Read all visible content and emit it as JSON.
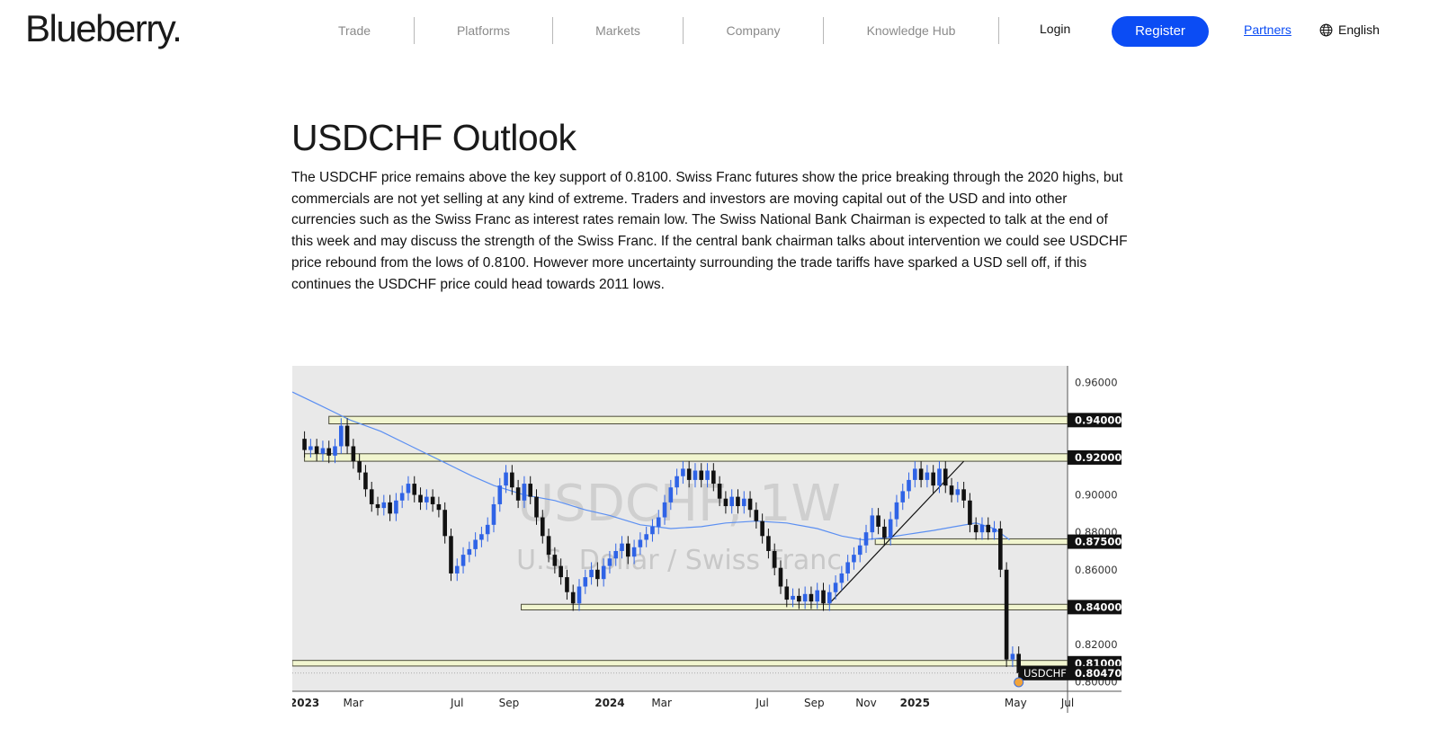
{
  "brand": {
    "logo_text": "Blueberry."
  },
  "nav": {
    "items": [
      "Trade",
      "Platforms",
      "Markets",
      "Company",
      "Knowledge Hub"
    ],
    "login": "Login",
    "register": "Register",
    "partners": "Partners",
    "language": "English"
  },
  "article": {
    "title": "USDCHF Outlook",
    "body": "The USDCHF price remains above the key support of 0.8100. Swiss Franc futures show the price breaking through the 2020 highs, but commercials are not yet selling at any kind of extreme. Traders and investors are moving capital out of the USD and into other currencies such as the Swiss Franc as interest rates remain low. The Swiss National Bank Chairman is expected to talk at the end of this week and may discuss the strength of the Swiss Franc. If the central bank chairman talks about intervention we could see USDCHF price rebound from the lows of 0.8100. However more uncertainty surrounding the trade tariffs have sparked a USD sell off, if this continues the USDCHF price could head towards 2011 lows."
  },
  "chart_data": {
    "type": "candlestick",
    "watermark": {
      "symbol": "USDCHF, 1W",
      "description": "U.S. Dollar / Swiss Franc"
    },
    "ylim": [
      0.795,
      0.969
    ],
    "y_ticks": [
      0.96,
      0.94,
      0.92,
      0.9,
      0.88,
      0.86,
      0.84,
      0.82,
      0.81,
      0.8
    ],
    "y_tick_labels": [
      "0.96000",
      "0.94000",
      "0.92000",
      "0.90000",
      "0.88000",
      "0.86000",
      "0.84000",
      "0.82000",
      "0.81000",
      "0.80000"
    ],
    "x_labels": [
      {
        "t": 2023.0,
        "label": "2023",
        "bold": true
      },
      {
        "t": 2023.16,
        "label": "Mar",
        "bold": false
      },
      {
        "t": 2023.5,
        "label": "Jul",
        "bold": false
      },
      {
        "t": 2023.67,
        "label": "Sep",
        "bold": false
      },
      {
        "t": 2024.0,
        "label": "2024",
        "bold": true
      },
      {
        "t": 2024.17,
        "label": "Mar",
        "bold": false
      },
      {
        "t": 2024.5,
        "label": "Jul",
        "bold": false
      },
      {
        "t": 2024.67,
        "label": "Sep",
        "bold": false
      },
      {
        "t": 2024.84,
        "label": "Nov",
        "bold": false
      },
      {
        "t": 2025.0,
        "label": "2025",
        "bold": true
      },
      {
        "t": 2025.33,
        "label": "May",
        "bold": false
      },
      {
        "t": 2025.5,
        "label": "Jul",
        "bold": false
      }
    ],
    "x_range": [
      2022.96,
      2025.5
    ],
    "support_zones": [
      {
        "price": 0.94,
        "label": "0.94000",
        "from": 2023.08,
        "width": 0.004
      },
      {
        "price": 0.92,
        "label": "0.92000",
        "from": 2023.0,
        "width": 0.004
      },
      {
        "price": 0.875,
        "label": "0.87500",
        "from": 2024.87,
        "width": 0.003
      },
      {
        "price": 0.84,
        "label": "0.84000",
        "from": 2023.71,
        "width": 0.003
      },
      {
        "price": 0.81,
        "label": "0.81000",
        "from": 2022.96,
        "width": 0.003
      }
    ],
    "current_price": {
      "symbol": "USDCHF",
      "value": "0.80470",
      "price": 0.8047
    },
    "trendline": {
      "from": [
        2024.72,
        0.842
      ],
      "to": [
        2025.16,
        0.918
      ]
    },
    "moving_average": [
      [
        2022.96,
        0.955
      ],
      [
        2023.05,
        0.948
      ],
      [
        2023.15,
        0.94
      ],
      [
        2023.25,
        0.934
      ],
      [
        2023.35,
        0.926
      ],
      [
        2023.45,
        0.918
      ],
      [
        2023.55,
        0.91
      ],
      [
        2023.62,
        0.905
      ],
      [
        2023.72,
        0.9
      ],
      [
        2023.82,
        0.897
      ],
      [
        2023.92,
        0.892
      ],
      [
        2024.0,
        0.889
      ],
      [
        2024.1,
        0.884
      ],
      [
        2024.2,
        0.882
      ],
      [
        2024.3,
        0.883
      ],
      [
        2024.38,
        0.885
      ],
      [
        2024.48,
        0.886
      ],
      [
        2024.58,
        0.885
      ],
      [
        2024.68,
        0.882
      ],
      [
        2024.76,
        0.878
      ],
      [
        2024.83,
        0.876
      ],
      [
        2024.9,
        0.877
      ],
      [
        2024.98,
        0.879
      ],
      [
        2025.06,
        0.881
      ],
      [
        2025.13,
        0.883
      ],
      [
        2025.2,
        0.885
      ],
      [
        2025.26,
        0.882
      ],
      [
        2025.31,
        0.876
      ]
    ],
    "candles": [
      [
        2023.0,
        0.93,
        0.924
      ],
      [
        2023.02,
        0.924,
        0.926
      ],
      [
        2023.04,
        0.926,
        0.922
      ],
      [
        2023.06,
        0.922,
        0.925
      ],
      [
        2023.08,
        0.925,
        0.921
      ],
      [
        2023.1,
        0.921,
        0.926
      ],
      [
        2023.12,
        0.926,
        0.937
      ],
      [
        2023.14,
        0.937,
        0.926
      ],
      [
        2023.16,
        0.926,
        0.918
      ],
      [
        2023.18,
        0.918,
        0.912
      ],
      [
        2023.2,
        0.912,
        0.903
      ],
      [
        2023.22,
        0.903,
        0.895
      ],
      [
        2023.24,
        0.895,
        0.893
      ],
      [
        2023.26,
        0.893,
        0.896
      ],
      [
        2023.28,
        0.896,
        0.89
      ],
      [
        2023.3,
        0.89,
        0.897
      ],
      [
        2023.32,
        0.897,
        0.901
      ],
      [
        2023.34,
        0.901,
        0.906
      ],
      [
        2023.36,
        0.906,
        0.9
      ],
      [
        2023.38,
        0.9,
        0.896
      ],
      [
        2023.4,
        0.896,
        0.899
      ],
      [
        2023.42,
        0.899,
        0.895
      ],
      [
        2023.44,
        0.895,
        0.892
      ],
      [
        2023.46,
        0.892,
        0.878
      ],
      [
        2023.48,
        0.878,
        0.858
      ],
      [
        2023.5,
        0.858,
        0.862
      ],
      [
        2023.52,
        0.862,
        0.868
      ],
      [
        2023.54,
        0.868,
        0.871
      ],
      [
        2023.56,
        0.871,
        0.876
      ],
      [
        2023.58,
        0.876,
        0.879
      ],
      [
        2023.6,
        0.879,
        0.884
      ],
      [
        2023.62,
        0.884,
        0.895
      ],
      [
        2023.64,
        0.895,
        0.905
      ],
      [
        2023.66,
        0.905,
        0.912
      ],
      [
        2023.68,
        0.912,
        0.904
      ],
      [
        2023.7,
        0.904,
        0.897
      ],
      [
        2023.72,
        0.897,
        0.906
      ],
      [
        2023.74,
        0.906,
        0.899
      ],
      [
        2023.76,
        0.899,
        0.888
      ],
      [
        2023.78,
        0.888,
        0.878
      ],
      [
        2023.8,
        0.878,
        0.868
      ],
      [
        2023.82,
        0.868,
        0.862
      ],
      [
        2023.84,
        0.862,
        0.856
      ],
      [
        2023.86,
        0.856,
        0.848
      ],
      [
        2023.88,
        0.848,
        0.842
      ],
      [
        2023.9,
        0.842,
        0.851
      ],
      [
        2023.92,
        0.851,
        0.856
      ],
      [
        2023.94,
        0.856,
        0.86
      ],
      [
        2023.96,
        0.86,
        0.855
      ],
      [
        2023.98,
        0.855,
        0.862
      ],
      [
        2024.0,
        0.862,
        0.866
      ],
      [
        2024.02,
        0.866,
        0.87
      ],
      [
        2024.04,
        0.87,
        0.874
      ],
      [
        2024.06,
        0.874,
        0.867
      ],
      [
        2024.08,
        0.867,
        0.872
      ],
      [
        2024.1,
        0.872,
        0.876
      ],
      [
        2024.12,
        0.876,
        0.879
      ],
      [
        2024.14,
        0.879,
        0.883
      ],
      [
        2024.16,
        0.883,
        0.888
      ],
      [
        2024.18,
        0.888,
        0.896
      ],
      [
        2024.2,
        0.896,
        0.904
      ],
      [
        2024.22,
        0.904,
        0.91
      ],
      [
        2024.24,
        0.91,
        0.914
      ],
      [
        2024.26,
        0.914,
        0.908
      ],
      [
        2024.28,
        0.908,
        0.913
      ],
      [
        2024.3,
        0.913,
        0.908
      ],
      [
        2024.32,
        0.908,
        0.913
      ],
      [
        2024.34,
        0.913,
        0.906
      ],
      [
        2024.36,
        0.906,
        0.898
      ],
      [
        2024.38,
        0.898,
        0.894
      ],
      [
        2024.4,
        0.894,
        0.899
      ],
      [
        2024.42,
        0.899,
        0.894
      ],
      [
        2024.44,
        0.894,
        0.898
      ],
      [
        2024.46,
        0.898,
        0.892
      ],
      [
        2024.48,
        0.892,
        0.886
      ],
      [
        2024.5,
        0.886,
        0.878
      ],
      [
        2024.52,
        0.878,
        0.87
      ],
      [
        2024.54,
        0.87,
        0.861
      ],
      [
        2024.56,
        0.861,
        0.851
      ],
      [
        2024.58,
        0.851,
        0.844
      ],
      [
        2024.6,
        0.844,
        0.846
      ],
      [
        2024.62,
        0.846,
        0.843
      ],
      [
        2024.64,
        0.843,
        0.847
      ],
      [
        2024.66,
        0.847,
        0.843
      ],
      [
        2024.68,
        0.843,
        0.849
      ],
      [
        2024.7,
        0.849,
        0.842
      ],
      [
        2024.72,
        0.842,
        0.848
      ],
      [
        2024.74,
        0.848,
        0.853
      ],
      [
        2024.76,
        0.853,
        0.858
      ],
      [
        2024.78,
        0.858,
        0.864
      ],
      [
        2024.8,
        0.864,
        0.868
      ],
      [
        2024.82,
        0.868,
        0.873
      ],
      [
        2024.84,
        0.873,
        0.88
      ],
      [
        2024.86,
        0.88,
        0.889
      ],
      [
        2024.88,
        0.889,
        0.883
      ],
      [
        2024.9,
        0.883,
        0.877
      ],
      [
        2024.92,
        0.877,
        0.887
      ],
      [
        2024.94,
        0.887,
        0.896
      ],
      [
        2024.96,
        0.896,
        0.902
      ],
      [
        2024.98,
        0.902,
        0.908
      ],
      [
        2025.0,
        0.908,
        0.914
      ],
      [
        2025.02,
        0.914,
        0.908
      ],
      [
        2025.04,
        0.908,
        0.912
      ],
      [
        2025.06,
        0.912,
        0.905
      ],
      [
        2025.08,
        0.905,
        0.914
      ],
      [
        2025.1,
        0.914,
        0.905
      ],
      [
        2025.12,
        0.905,
        0.9
      ],
      [
        2025.14,
        0.9,
        0.903
      ],
      [
        2025.16,
        0.903,
        0.897
      ],
      [
        2025.18,
        0.897,
        0.884
      ],
      [
        2025.2,
        0.884,
        0.88
      ],
      [
        2025.22,
        0.88,
        0.884
      ],
      [
        2025.24,
        0.884,
        0.88
      ],
      [
        2025.26,
        0.88,
        0.882
      ],
      [
        2025.28,
        0.882,
        0.86
      ],
      [
        2025.3,
        0.86,
        0.812
      ],
      [
        2025.32,
        0.812,
        0.815
      ],
      [
        2025.34,
        0.815,
        0.8047
      ]
    ]
  }
}
